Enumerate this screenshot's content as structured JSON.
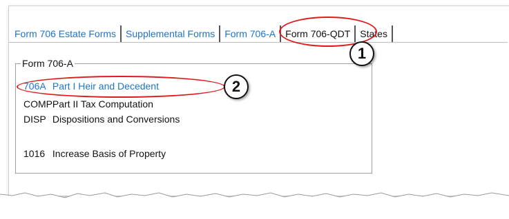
{
  "tabs": [
    {
      "label": "Form 706 Estate Forms",
      "active": false
    },
    {
      "label": "Supplemental Forms",
      "active": false
    },
    {
      "label": "Form 706-A",
      "active": true
    },
    {
      "label": "Form 706-QDT",
      "active": false
    },
    {
      "label": "States",
      "active": false
    }
  ],
  "group": {
    "title": "Form 706-A",
    "items": [
      {
        "code": "706A",
        "label": "Part I Heir and Decedent"
      },
      {
        "code": "COMP",
        "label": "Part II Tax Computation"
      },
      {
        "code": "DISP",
        "label": "Dispositions and Conversions"
      },
      {
        "code": "1016",
        "label": "Increase Basis of Property"
      }
    ]
  },
  "callouts": {
    "one": "1",
    "two": "2"
  },
  "colors": {
    "link": "#1e73c7",
    "callout": "#e01a1a"
  }
}
